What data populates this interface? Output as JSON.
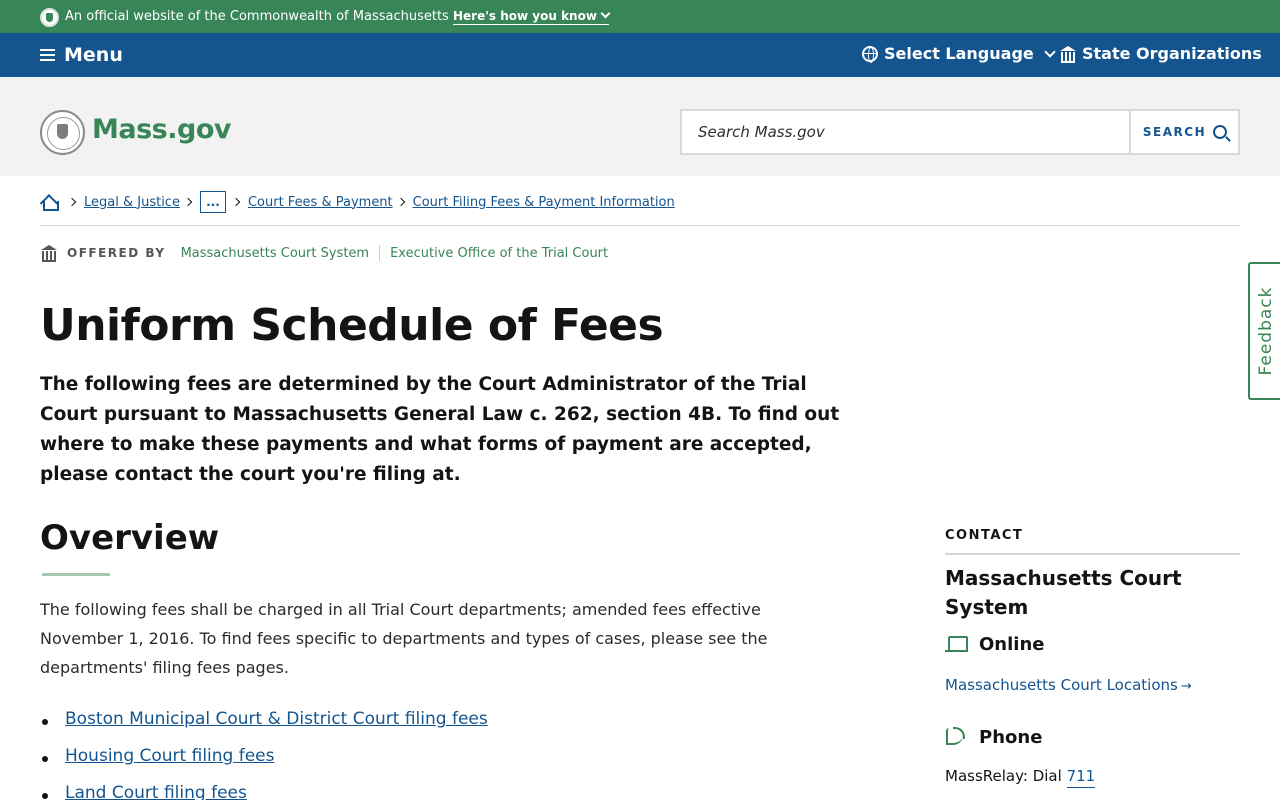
{
  "official_banner": {
    "text": "An official website of the Commonwealth of Massachusetts",
    "link": "Here's how you know"
  },
  "nav": {
    "menu_label": "Menu",
    "language_label": "Select Language",
    "orgs_label": "State Organizations"
  },
  "header": {
    "logo_text": "Mass.gov",
    "search_placeholder": "Search Mass.gov",
    "search_button": "SEARCH"
  },
  "breadcrumb": {
    "items": [
      "Legal & Justice",
      "...",
      "Court Fees & Payment",
      "Court Filing Fees & Payment Information"
    ]
  },
  "offered_by": {
    "label": "OFFERED BY",
    "orgs": [
      "Massachusetts Court System",
      "Executive Office of the Trial Court"
    ]
  },
  "page": {
    "title": "Uniform Schedule of Fees",
    "lede": "The following fees are determined by the Court Administrator of the Trial Court pursuant to Massachusetts General Law c. 262, section 4B. To find out where to make these payments and what forms of payment are accepted, please contact the court you're filing at."
  },
  "overview": {
    "heading": "Overview",
    "text": "The following fees shall be charged in all Trial Court departments; amended fees effective November 1, 2016. To find fees specific to departments and types of cases, please see the departments' filing fees pages.",
    "links": [
      "Boston Municipal Court & District Court filing fees",
      "Housing Court filing fees",
      "Land Court filing fees"
    ]
  },
  "contact": {
    "label": "CONTACT",
    "name": "Massachusetts Court System",
    "online_heading": "Online",
    "online_link": "Massachusetts Court Locations",
    "phone_heading": "Phone",
    "relay_prefix": "MassRelay: Dial",
    "relay_number": "711"
  },
  "feedback": {
    "label": "Feedback"
  },
  "colors": {
    "banner_green": "#388557",
    "nav_blue": "#14558f",
    "link_blue": "#14558f",
    "header_gray": "#f2f2f2"
  }
}
